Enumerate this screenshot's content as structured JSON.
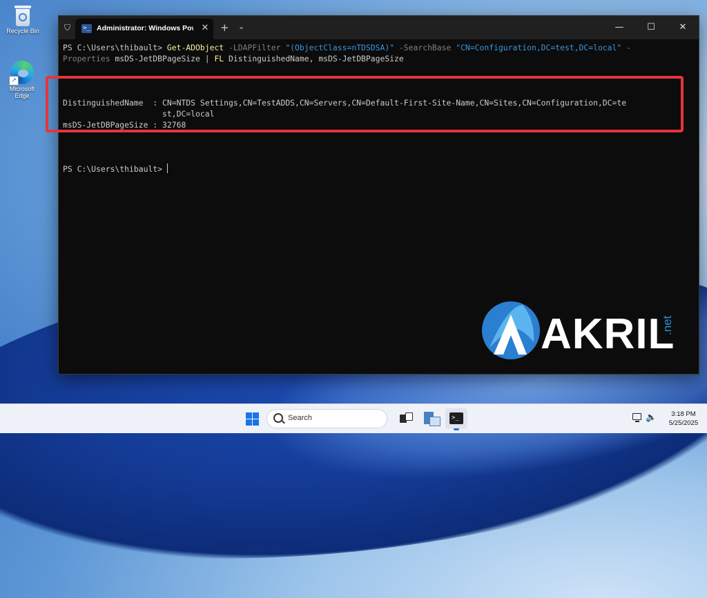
{
  "desktop": {
    "icons": [
      {
        "label": "Recycle Bin",
        "icon": "recycle-bin-icon"
      },
      {
        "label": "Microsoft Edge",
        "icon": "edge-icon"
      }
    ]
  },
  "window": {
    "tab_title": "Administrator: Windows PowerShell",
    "tab_close": "✕",
    "new_tab": "+",
    "dropdown": "⌄",
    "controls": {
      "minimize": "—",
      "maximize": "☐",
      "close": "✕"
    }
  },
  "console": {
    "line1": {
      "prompt": "PS C:\\Users\\thibault> ",
      "cmdlet": "Get-ADObject",
      "p1": " -LDAPFilter ",
      "s1": "\"(ObjectClass=nTDSDSA)\"",
      "p2": " -SearchBase ",
      "s2": "\"CN=Configuration,DC=test,DC=local\"",
      "p3": " -"
    },
    "line2": {
      "p1": "Properties",
      "a1": " msDS-JetDBPageSize | ",
      "cmdlet": "FL",
      "a2": " DistinguishedName, msDS-JetDBPageSize"
    },
    "output": [
      "DistinguishedName  : CN=NTDS Settings,CN=TestADDS,CN=Servers,CN=Default-First-Site-Name,CN=Sites,CN=Configuration,DC=te",
      "                     st,DC=local",
      "msDS-JetDBPageSize : 32768"
    ],
    "prompt2": "PS C:\\Users\\thibault> "
  },
  "watermark": {
    "text": "AKRIL",
    "suffix": ".net"
  },
  "taskbar": {
    "search_label": "Search",
    "clock_time": "3:18 PM",
    "clock_date": "5/25/2025"
  },
  "colors": {
    "highlight": "#e8333c",
    "cmdlet": "#f9f1a5",
    "string": "#3a96dd",
    "parameter": "#808080"
  }
}
